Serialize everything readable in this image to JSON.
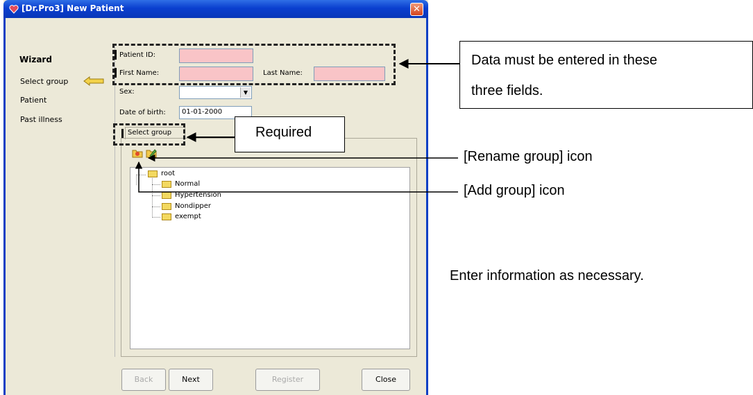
{
  "window": {
    "title": "[Dr.Pro3] New Patient",
    "close_glyph": "✕"
  },
  "wizard": {
    "title": "Wizard",
    "steps": [
      "Select group",
      "Patient",
      "Past illness"
    ]
  },
  "form": {
    "patient_id_label": "Patient ID:",
    "first_name_label": "First Name:",
    "last_name_label": "Last Name:",
    "sex_label": "Sex:",
    "sex_value": "",
    "dob_label": "Date of birth:",
    "dob_value": "01-01-2000",
    "select_group_tab": "Select group"
  },
  "tree": {
    "root": "root",
    "children": [
      "Normal",
      "Hypertension",
      "Nondipper",
      "exempt"
    ]
  },
  "buttons": {
    "back": "Back",
    "next": "Next",
    "register": "Register",
    "close": "Close"
  },
  "annotations": {
    "data_required": "Data must be entered in these",
    "data_required_2": "three fields.",
    "required": "Required",
    "rename_group": "[Rename group] icon",
    "add_group": "[Add group] icon",
    "enter_info": "Enter information as necessary."
  },
  "colors": {
    "required_field": "#f9c4c7",
    "titlebar": "#0a3fcf",
    "window_bg": "#ece9d8"
  }
}
